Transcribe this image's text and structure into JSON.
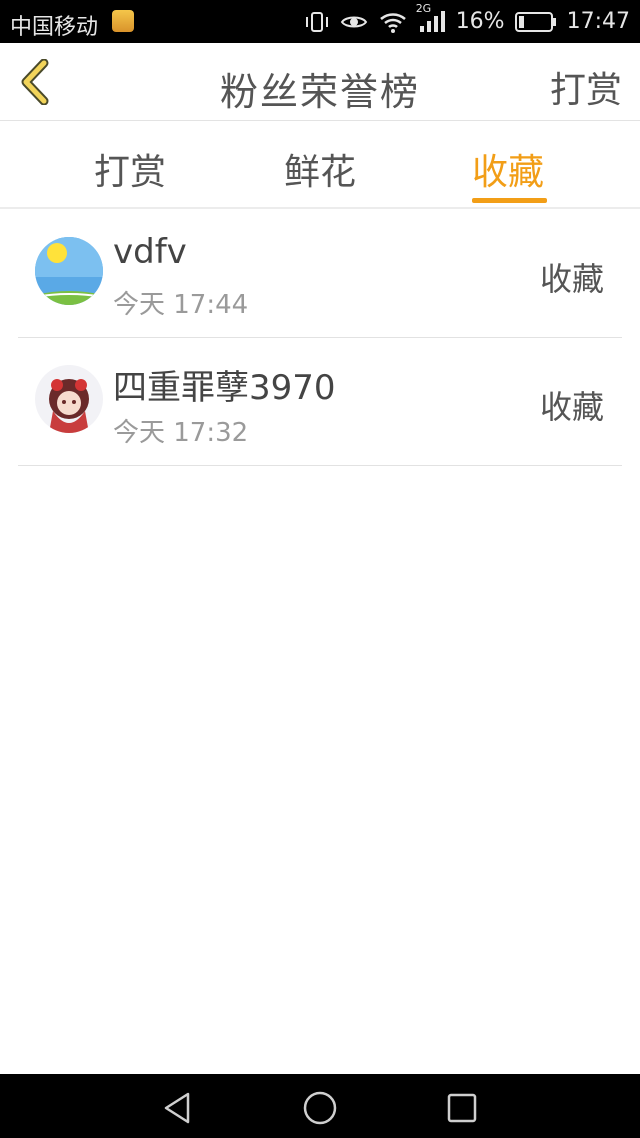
{
  "status_bar": {
    "carrier": "中国移动",
    "network": "2G",
    "battery": "16%",
    "time": "17:47"
  },
  "header": {
    "title": "粉丝荣誉榜",
    "right_action": "打赏"
  },
  "tabs": [
    {
      "label": "打赏",
      "active": false
    },
    {
      "label": "鲜花",
      "active": false
    },
    {
      "label": "收藏",
      "active": true
    }
  ],
  "list": [
    {
      "name": "vdfv",
      "time": "今天 17:44",
      "tag": "收藏"
    },
    {
      "name": "四重罪孽3970",
      "time": "今天 17:32",
      "tag": "收藏"
    }
  ],
  "colors": {
    "accent": "#f29e17",
    "text": "#555555",
    "muted": "#9a9a9a"
  }
}
